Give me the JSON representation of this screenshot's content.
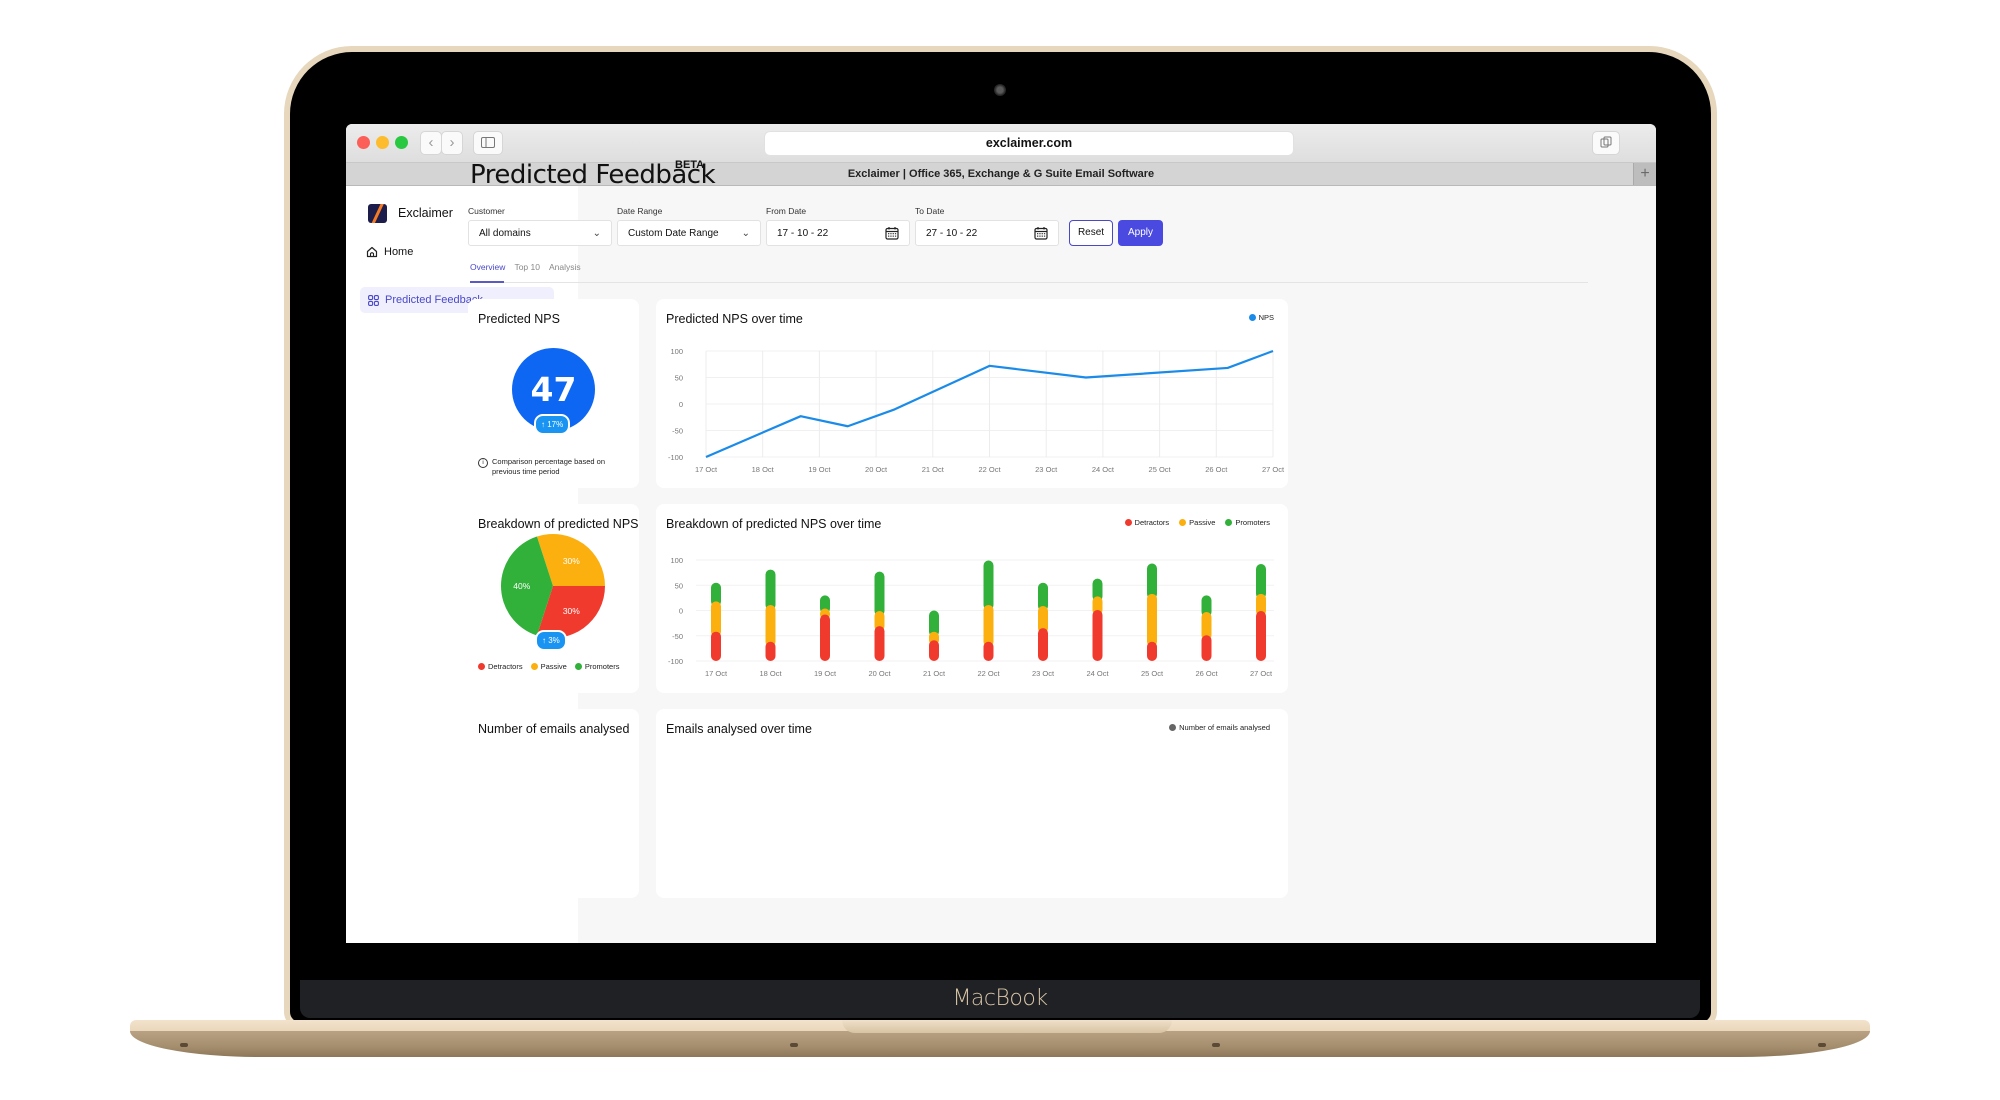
{
  "device": {
    "label": "MacBook"
  },
  "browser": {
    "url": "exclaimer.com",
    "tab_title": "Exclaimer | Office 365, Exchange & G Suite Email Software",
    "new_tab_label": "+",
    "back_label": "‹",
    "forward_label": "›"
  },
  "sidebar": {
    "brand": "Exclaimer",
    "items": [
      {
        "label": "Home",
        "icon": "home-icon",
        "active": false
      },
      {
        "label": "Predicted Feedback",
        "icon": "grid-icon",
        "active": true
      }
    ]
  },
  "header": {
    "title": "Predicted Feedback",
    "badge": "BETA"
  },
  "filters": {
    "customer": {
      "label": "Customer",
      "value": "All domains"
    },
    "date_range": {
      "label": "Date Range",
      "value": "Custom Date Range"
    },
    "from_date": {
      "label": "From Date",
      "value": "17 - 10 - 22"
    },
    "to_date": {
      "label": "To Date",
      "value": "27 - 10 - 22"
    },
    "reset_label": "Reset",
    "apply_label": "Apply"
  },
  "tabs": [
    {
      "label": "Overview",
      "active": true
    },
    {
      "label": "Top 10",
      "active": false
    },
    {
      "label": "Analysis",
      "active": false
    }
  ],
  "cards": {
    "predicted_nps": {
      "title": "Predicted NPS",
      "value": "47",
      "change": "↑ 17%",
      "note": "Comparison percentage based on previous time period"
    },
    "nps_over_time": {
      "title": "Predicted NPS over time",
      "legend": "NPS"
    },
    "breakdown": {
      "title": "Breakdown of predicted NPS",
      "change": "↑ 3%",
      "legend": [
        "Detractors",
        "Passive",
        "Promoters"
      ]
    },
    "breakdown_over_time": {
      "title": "Breakdown of predicted NPS over time",
      "legend": [
        "Detractors",
        "Passive",
        "Promoters"
      ]
    },
    "emails_count": {
      "title": "Number of emails analysed"
    },
    "emails_over_time": {
      "title": "Emails analysed over time",
      "legend": "Number of emails analysed"
    }
  },
  "colors": {
    "accent": "#4b4ae0",
    "nps_blue": "#0d67f2",
    "line_blue": "#1a8be8",
    "detractors": "#f03a2e",
    "passive": "#fbb00f",
    "promoters": "#31b03a",
    "emails_grey": "#666666"
  },
  "chart_data": [
    {
      "type": "line",
      "title": "Predicted NPS over time",
      "categories": [
        "17 Oct",
        "18 Oct",
        "19 Oct",
        "20 Oct",
        "21 Oct",
        "22 Oct",
        "23 Oct",
        "24 Oct",
        "25 Oct",
        "26 Oct",
        "27 Oct"
      ],
      "yticks": [
        100,
        50,
        0,
        -50,
        -100
      ],
      "ylim": [
        -100,
        100
      ],
      "legend": "top-right",
      "grid": true,
      "series": [
        {
          "name": "NPS",
          "points": [
            [
              0,
              -100
            ],
            [
              1.67,
              -23
            ],
            [
              2.5,
              -42
            ],
            [
              3.33,
              -10
            ],
            [
              5,
              72
            ],
            [
              6.7,
              50
            ],
            [
              9.2,
              68
            ],
            [
              10,
              100
            ]
          ]
        }
      ]
    },
    {
      "type": "pie",
      "title": "Breakdown of predicted NPS",
      "slices": [
        {
          "label": "Passive",
          "value": 30
        },
        {
          "label": "Detractors",
          "value": 30
        },
        {
          "label": "Promoters",
          "value": 40
        }
      ],
      "legend": "bottom"
    },
    {
      "type": "bar",
      "stacked": true,
      "title": "Breakdown of predicted NPS over time",
      "categories": [
        "17 Oct",
        "18 Oct",
        "19 Oct",
        "20 Oct",
        "21 Oct",
        "22 Oct",
        "23 Oct",
        "24 Oct",
        "25 Oct",
        "26 Oct",
        "27 Oct"
      ],
      "yticks": [
        100,
        50,
        0,
        -50,
        -100
      ],
      "ylim": [
        -100,
        100
      ],
      "baseline": -100,
      "legend": "top-right",
      "series": [
        {
          "name": "Detractors",
          "tops": [
            -42,
            -62,
            -8,
            -31,
            -59,
            -62,
            -35,
            1,
            -62,
            -49,
            -1
          ]
        },
        {
          "name": "Passive",
          "tops": [
            18,
            11,
            4,
            -1,
            -42,
            11,
            9,
            28,
            33,
            -3,
            33
          ]
        },
        {
          "name": "Promoters",
          "tops": [
            55,
            81,
            30,
            77,
            0,
            99,
            55,
            63,
            93,
            30,
            92
          ]
        }
      ]
    }
  ]
}
